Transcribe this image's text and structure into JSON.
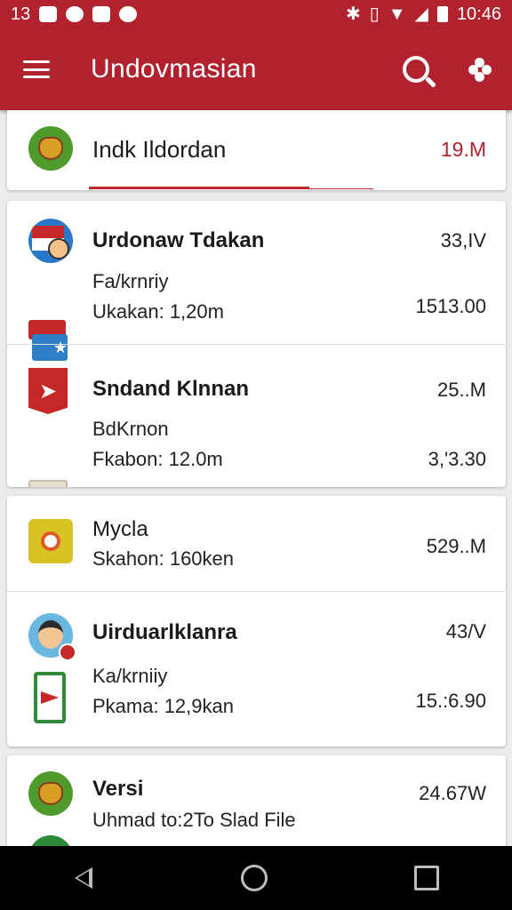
{
  "status_bar": {
    "left_text": "13",
    "time": "10:46"
  },
  "app_bar": {
    "title": "Undovmasian"
  },
  "header_card": {
    "title": "Indk Ildordan",
    "value": "19.M"
  },
  "cards": [
    {
      "rows": [
        {
          "title": "Urdonaw Tdakan",
          "value": "33,IV"
        },
        {
          "sub1": "Fa/krnriy",
          "sub2": "Ukakan: 1,20m",
          "value": "1513.00"
        }
      ]
    },
    {
      "rows": [
        {
          "title": "Sndand Klnnan",
          "value": "25..M"
        },
        {
          "sub1": "BdKrnon",
          "sub2": "Fkabon: 12.0m",
          "value": "3,'3.30"
        }
      ]
    },
    {
      "rows": [
        {
          "title": "Mycla",
          "sub2": "Skahon: 160ken",
          "value": "529..M"
        }
      ]
    },
    {
      "rows": [
        {
          "title": "Uirduarlklanra",
          "value": "43/V"
        },
        {
          "sub1": "Ka/krniiy",
          "sub2": "Pkama: 12,9kan",
          "value": "15.:6.90"
        }
      ]
    },
    {
      "rows": [
        {
          "title": "Versi",
          "sub1": "Uhmad to:2To Slad File",
          "value": "24.67W"
        }
      ]
    }
  ],
  "icons": {
    "status": [
      "sim-icon",
      "image-icon",
      "whatsapp-icon",
      "bag-icon",
      "dot-icon",
      "bluetooth-icon",
      "vibrate-icon",
      "wifi-icon",
      "signal-icon",
      "battery-icon"
    ],
    "nav": [
      "back-icon",
      "home-icon",
      "recents-icon"
    ]
  },
  "colors": {
    "primary": "#b1222e",
    "value_red": "#b1222e",
    "background": "#ececec"
  }
}
